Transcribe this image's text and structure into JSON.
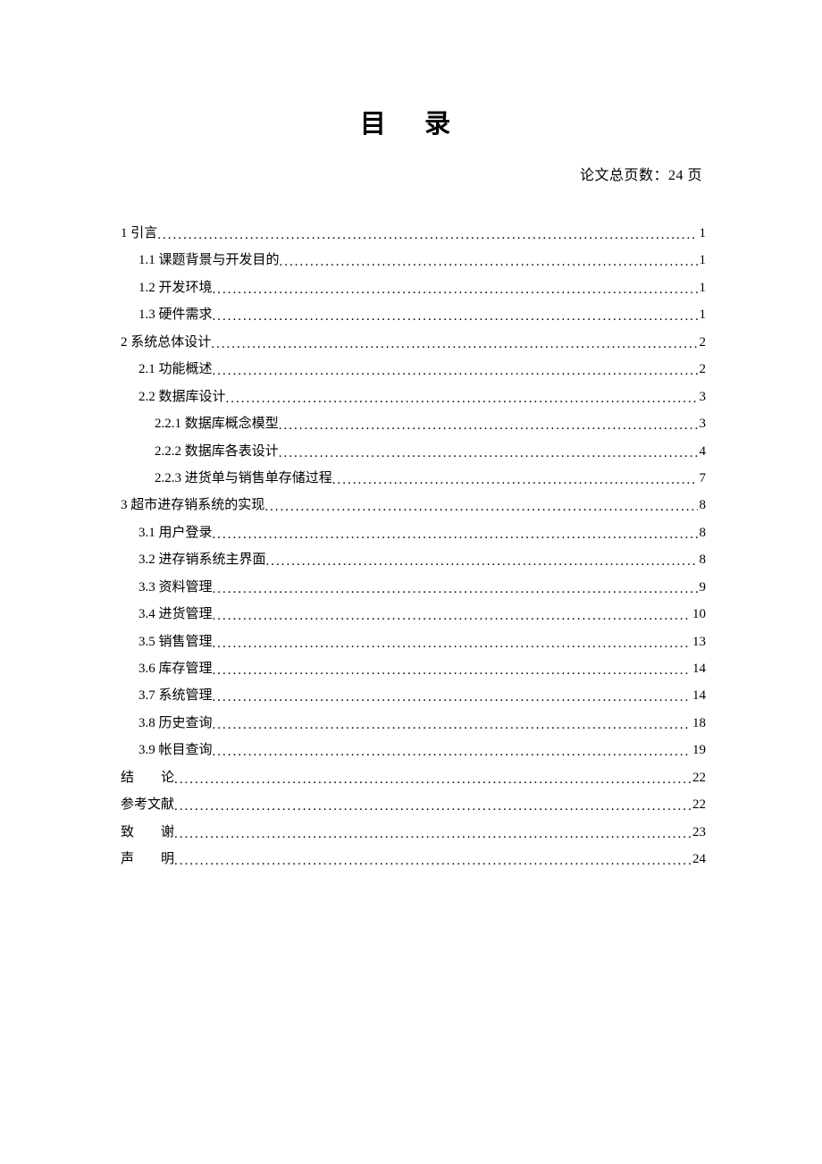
{
  "title": "目 录",
  "page_count_text": "论文总页数：24 页",
  "toc": [
    {
      "indent": 0,
      "label": "1 引言",
      "page": "1"
    },
    {
      "indent": 1,
      "label": "1.1 课题背景与开发目的",
      "page": "1"
    },
    {
      "indent": 1,
      "label": "1.2 开发环境",
      "page": "1"
    },
    {
      "indent": 1,
      "label": "1.3 硬件需求",
      "page": "1"
    },
    {
      "indent": 0,
      "label": "2 系统总体设计",
      "page": "2"
    },
    {
      "indent": 1,
      "label": "2.1 功能概述",
      "page": "2"
    },
    {
      "indent": 1,
      "label": "2.2 数据库设计",
      "page": "3"
    },
    {
      "indent": 2,
      "label": "2.2.1 数据库概念模型",
      "page": "3"
    },
    {
      "indent": 2,
      "label": "2.2.2 数据库各表设计",
      "page": "4"
    },
    {
      "indent": 2,
      "label": "2.2.3 进货单与销售单存储过程",
      "page": "7"
    },
    {
      "indent": 0,
      "label": "3 超市进存销系统的实现",
      "page": "8"
    },
    {
      "indent": 1,
      "label": "3.1 用户登录",
      "page": "8"
    },
    {
      "indent": 1,
      "label": "3.2 进存销系统主界面",
      "page": "8"
    },
    {
      "indent": 1,
      "label": "3.3 资料管理",
      "page": "9"
    },
    {
      "indent": 1,
      "label": "3.4 进货管理",
      "page": "10"
    },
    {
      "indent": 1,
      "label": "3.5 销售管理",
      "page": "13"
    },
    {
      "indent": 1,
      "label": "3.6 库存管理",
      "page": "14"
    },
    {
      "indent": 1,
      "label": "3.7 系统管理",
      "page": "14"
    },
    {
      "indent": 1,
      "label": "3.8 历史查询",
      "page": "18"
    },
    {
      "indent": 1,
      "label": "3.9 帐目查询",
      "page": "19"
    },
    {
      "indent": 0,
      "label": "结　　论",
      "page": "22"
    },
    {
      "indent": 0,
      "label": "参考文献",
      "page": "22"
    },
    {
      "indent": 0,
      "label": "致　　谢",
      "page": "23"
    },
    {
      "indent": 0,
      "label": "声　　明",
      "page": "24"
    }
  ]
}
